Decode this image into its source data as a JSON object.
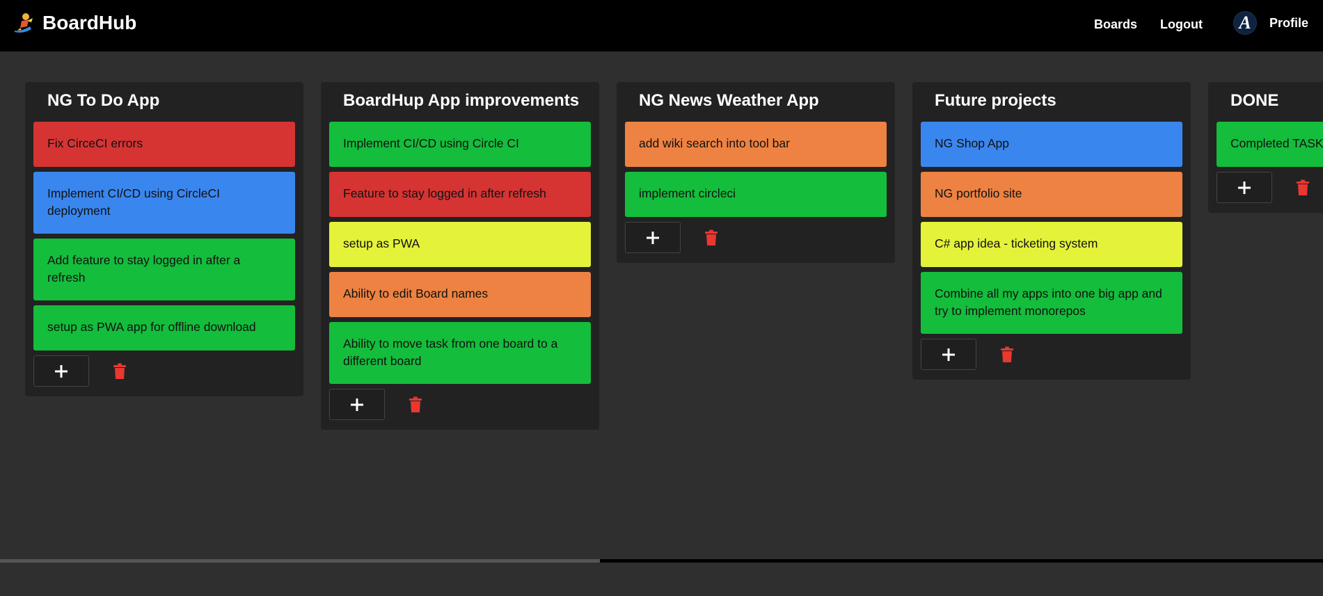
{
  "app": {
    "name": "BoardHub"
  },
  "nav": {
    "boards": "Boards",
    "logout": "Logout",
    "profile": "Profile",
    "avatar_letter": "A"
  },
  "icons": {
    "logo": "rocket-surfer-icon",
    "add": "plus-icon",
    "delete": "trash-icon",
    "avatar": "a-logo-icon"
  },
  "colors": {
    "red": "#d63333",
    "blue": "#3a86ef",
    "green": "#14bd3c",
    "yellow": "#e5f23a",
    "orange": "#ed8242",
    "trash": "#e8382f"
  },
  "boards": [
    {
      "title": "NG To Do App",
      "cards": [
        {
          "text": "Fix CirceCI errors",
          "color": "red"
        },
        {
          "text": "Implement CI/CD using CircleCI deployment",
          "color": "blue"
        },
        {
          "text": "Add feature to stay logged in after a refresh",
          "color": "green"
        },
        {
          "text": "setup as PWA app for offline download",
          "color": "green"
        }
      ]
    },
    {
      "title": "BoardHup App improvements",
      "cards": [
        {
          "text": "Implement CI/CD using Circle CI",
          "color": "green"
        },
        {
          "text": "Feature to stay logged in after refresh",
          "color": "red"
        },
        {
          "text": "setup as PWA",
          "color": "yellow"
        },
        {
          "text": "Ability to edit Board names",
          "color": "orange"
        },
        {
          "text": "Ability to move task from one board to a different board",
          "color": "green"
        }
      ]
    },
    {
      "title": "NG News Weather App",
      "cards": [
        {
          "text": "add wiki search into tool bar",
          "color": "orange"
        },
        {
          "text": "implement circleci",
          "color": "green"
        }
      ]
    },
    {
      "title": "Future projects",
      "cards": [
        {
          "text": "NG Shop App",
          "color": "blue"
        },
        {
          "text": "NG portfolio site",
          "color": "orange"
        },
        {
          "text": "C# app idea - ticketing system",
          "color": "yellow"
        },
        {
          "text": "Combine all my apps into one big app and try to implement monorepos",
          "color": "green"
        }
      ]
    },
    {
      "title": "DONE",
      "cards": [
        {
          "text": "Completed TASKS",
          "color": "green"
        }
      ]
    }
  ]
}
